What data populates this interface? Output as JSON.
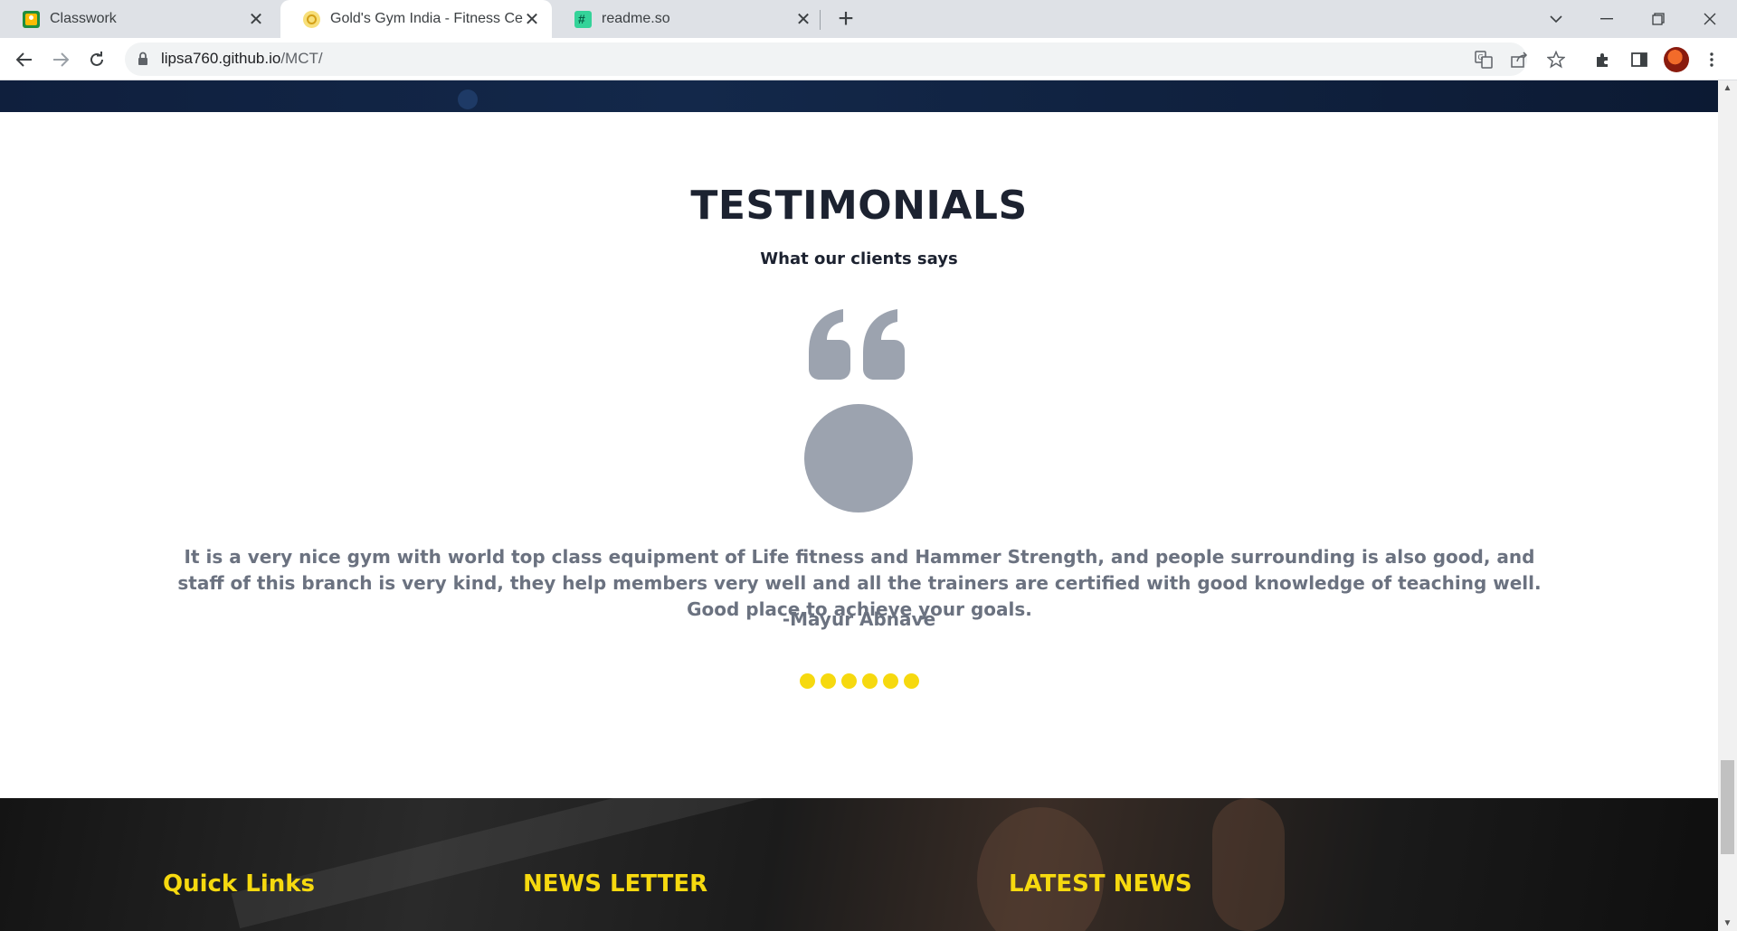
{
  "browser": {
    "tabs": [
      {
        "title": "Classwork",
        "favicon": "google-classroom-icon",
        "active": false
      },
      {
        "title": "Gold's Gym India - Fitness Center",
        "favicon": "golds-gym-icon",
        "active": true
      },
      {
        "title": "readme.so",
        "favicon": "readme-so-icon",
        "active": false
      }
    ],
    "close_glyph": "✕",
    "new_tab_glyph": "+",
    "url_host": "lipsa760.github.io",
    "url_path": "/MCT/"
  },
  "testimonials": {
    "heading": "TESTIMONIALS",
    "subheading": "What our clients says",
    "quote": "It is a very nice gym with world top class equipment of Life fitness and Hammer Strength, and people surrounding is also good, and staff of this branch is very kind, they help members very well and all the trainers are certified with good knowledge of teaching well. Good place to achieve your goals.",
    "author": "-Mayur Abnave",
    "pagination_dots": 6,
    "accent_color": "#f6d90f",
    "muted_color": "#9ca3af"
  },
  "footer": {
    "columns": [
      {
        "title": "Quick Links"
      },
      {
        "title": "NEWS LETTER"
      },
      {
        "title": "LATEST NEWS"
      }
    ],
    "title_color": "#f6d90f"
  }
}
